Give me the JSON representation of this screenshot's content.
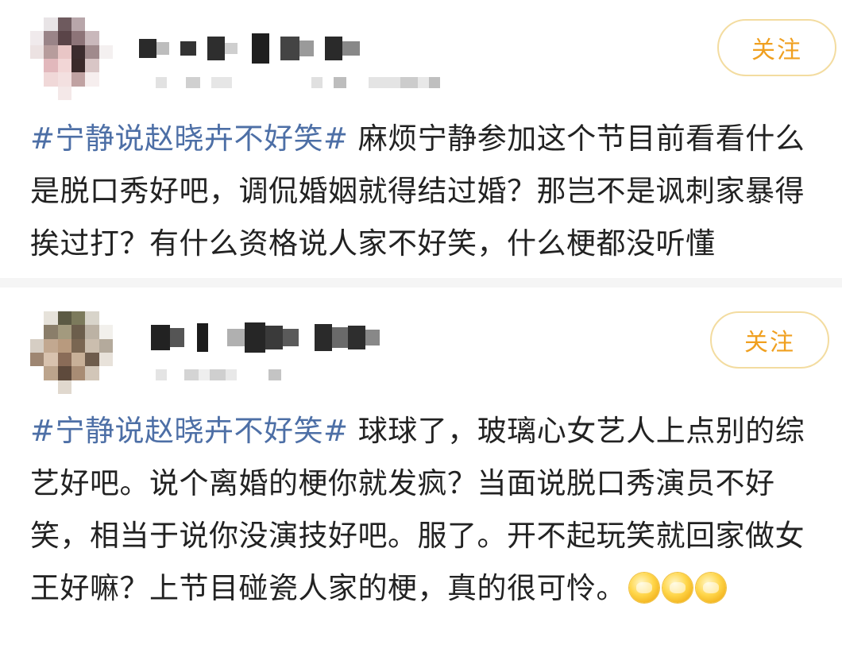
{
  "posts": [
    {
      "follow_label": "关注",
      "hashtag": "#宁静说赵晓卉不好笑#",
      "body": " 麻烦宁静参加这个节目前看看什么是脱口秀好吧，调侃婚姻就得结过婚？那岂不是讽刺家暴得挨过打？有什么资格说人家不好笑，什么梗都没听懂",
      "emoji_count": 0
    },
    {
      "follow_label": "关注",
      "hashtag": "#宁静说赵晓卉不好笑#",
      "body": " 球球了，玻璃心女艺人上点别的综艺好吧。说个离婚的梗你就发疯？当面说脱口秀演员不好笑，相当于说你没演技好吧。服了。开不起玩笑就回家做女王好嘛？上节目碰瓷人家的梗，真的很可怜。",
      "emoji_count": 3
    }
  ],
  "colors": {
    "hashtag": "#4d6fa6",
    "follow_text": "#f0a020",
    "follow_border": "#f3dca0",
    "body_text": "#222222"
  },
  "icons": {
    "emoji": "grinning-face-emoji"
  }
}
